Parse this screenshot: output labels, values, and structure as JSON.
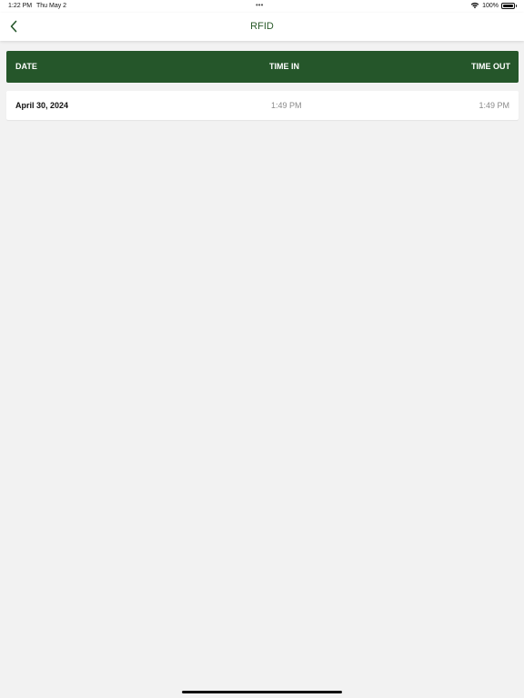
{
  "status_bar": {
    "time": "1:22 PM",
    "date": "Thu May 2",
    "dots": "•••",
    "battery_pct": "100%"
  },
  "nav": {
    "title": "RFID",
    "back_icon": "chevron-left-icon"
  },
  "table": {
    "headers": [
      "DATE",
      "TIME IN",
      "TIME OUT"
    ],
    "rows": [
      {
        "date": "April 30, 2024",
        "time_in": "1:49 PM",
        "time_out": "1:49 PM"
      }
    ]
  },
  "colors": {
    "accent": "#25562a",
    "title": "#2a5a2a",
    "background": "#f2f2f2"
  }
}
